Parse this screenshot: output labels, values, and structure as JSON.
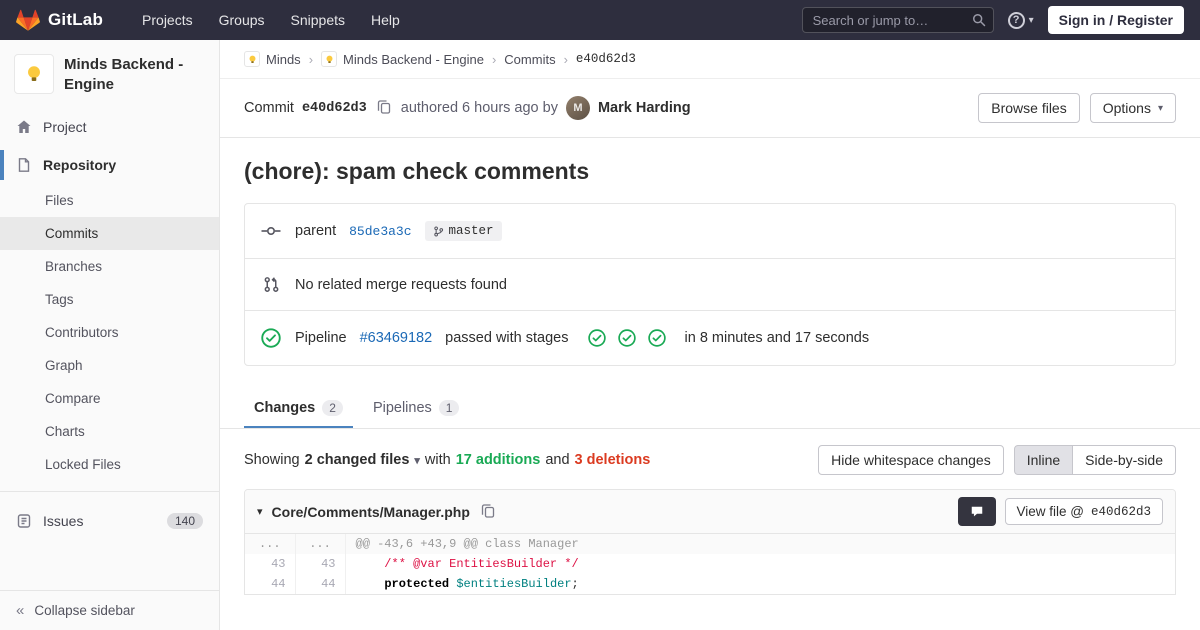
{
  "colors": {
    "navbar_bg": "#2e2e3e",
    "accent_blue": "#1b69b6",
    "success_green": "#1aaa55",
    "danger_red": "#db3b21",
    "sidebar_active_indicator": "#4b83be"
  },
  "icons": {
    "caret_down": "▾",
    "collapse": "«",
    "question": "?",
    "disclosure": "▾",
    "separator": "›"
  },
  "navbar": {
    "brand": "GitLab",
    "menu": [
      {
        "label": "Projects"
      },
      {
        "label": "Groups"
      },
      {
        "label": "Snippets"
      },
      {
        "label": "Help"
      }
    ],
    "search_placeholder": "Search or jump to…",
    "sign_in_label": "Sign in / Register"
  },
  "sidebar": {
    "project_title": "Minds Backend - Engine",
    "project_item": "Project",
    "repository_item": "Repository",
    "repo_subitems": [
      {
        "label": "Files"
      },
      {
        "label": "Commits",
        "active": true
      },
      {
        "label": "Branches"
      },
      {
        "label": "Tags"
      },
      {
        "label": "Contributors"
      },
      {
        "label": "Graph"
      },
      {
        "label": "Compare"
      },
      {
        "label": "Charts"
      },
      {
        "label": "Locked Files"
      }
    ],
    "issues_label": "Issues",
    "issues_count": "140",
    "collapse_label": "Collapse sidebar"
  },
  "breadcrumb": {
    "group": "Minds",
    "project": "Minds Backend - Engine",
    "section": "Commits",
    "current": "e40d62d3"
  },
  "commit_header": {
    "label": "Commit",
    "sha": "e40d62d3",
    "authored": "authored 6 hours ago by",
    "author": "Mark Harding",
    "author_initial": "M",
    "browse_files": "Browse files",
    "options": "Options"
  },
  "commit": {
    "title": "(chore): spam check comments",
    "parent_label": "parent",
    "parent_sha": "85de3a3c",
    "branch": "master",
    "mr_text": "No related merge requests found",
    "pipeline_label": "Pipeline",
    "pipeline_id": "#63469182",
    "pipeline_status": "passed with stages",
    "pipeline_duration": "in 8 minutes and 17 seconds"
  },
  "tabs": {
    "changes_label": "Changes",
    "changes_count": "2",
    "pipelines_label": "Pipelines",
    "pipelines_count": "1"
  },
  "summary": {
    "showing": "Showing",
    "files_dropdown": "2 changed files",
    "with_text": "with",
    "additions": "17 additions",
    "and_text": "and",
    "deletions": "3 deletions",
    "hide_whitespace": "Hide whitespace changes",
    "inline": "Inline",
    "side_by_side": "Side-by-side"
  },
  "diff": {
    "file_path": "Core/Comments/Manager.php",
    "view_file_label": "View file @",
    "view_file_sha": "e40d62d3",
    "hunk_old": "...",
    "hunk_new": "...",
    "hunk_header": "@@ -43,6 +43,9 @@ class Manager",
    "lines": [
      {
        "old": "43",
        "new": "43",
        "comment": "    /** @var EntitiesBuilder */"
      },
      {
        "old": "44",
        "new": "44",
        "indent": "    ",
        "keyword": "protected",
        "space": " ",
        "variable": "$entitiesBuilder",
        "end": ";"
      }
    ]
  }
}
